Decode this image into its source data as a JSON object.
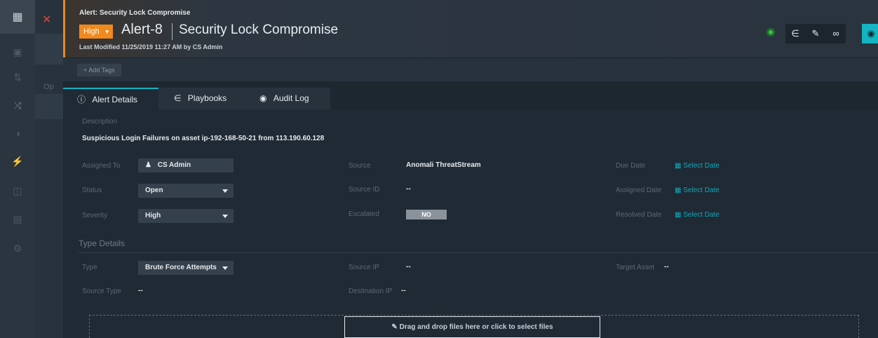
{
  "rail": {
    "icons": [
      "apps-icon",
      "dashboard-icon",
      "sort-icon",
      "shuffle-icon",
      "shield-icon",
      "bolt-icon",
      "briefcase-icon",
      "chart-icon",
      "settings-icon"
    ]
  },
  "back_panel": {
    "partial_label": "Op"
  },
  "header": {
    "breadcrumb": "Alert: Security Lock Compromise",
    "severity": "High",
    "alert_id": "Alert-8",
    "alert_name": "Security Lock Compromise",
    "last_modified": "Last Modified 11/25/2019 11:27 AM by CS Admin",
    "status_dot_color": "#3ac04b",
    "accent_color": "#f08a1d"
  },
  "tags": {
    "add_label": "+ Add Tags"
  },
  "tabs": [
    {
      "label": "Alert Details",
      "icon": "info-icon",
      "active": true
    },
    {
      "label": "Playbooks",
      "icon": "playbook-icon",
      "active": false
    },
    {
      "label": "Audit Log",
      "icon": "eye-icon",
      "active": false
    }
  ],
  "details": {
    "description_label": "Description",
    "description": "Suspicious Login Failures on asset ip-192-168-50-21 from 113.190.60.128",
    "assigned_to_label": "Assigned To",
    "assigned_to": "CS Admin",
    "status_label": "Status",
    "status": "Open",
    "severity_label": "Severity",
    "severity": "High",
    "source_label": "Source",
    "source": "Anomali ThreatStream",
    "source_id_label": "Source ID",
    "source_id": "--",
    "escalated_label": "Escalated",
    "escalated": "NO",
    "due_date_label": "Due Date",
    "assigned_date_label": "Assigned Date",
    "resolved_date_label": "Resolved Date",
    "select_date": "Select Date"
  },
  "type_details": {
    "heading": "Type Details",
    "type_label": "Type",
    "type": "Brute Force Attempts",
    "source_type_label": "Source Type",
    "source_type": "--",
    "source_ip_label": "Source IP",
    "source_ip": "--",
    "destination_ip_label": "Destination IP",
    "destination_ip": "--",
    "target_asset_label": "Target Asset",
    "target_asset": "--"
  },
  "upload": {
    "label": "Drag and drop files here or click to select files"
  },
  "colors": {
    "link": "#14a7b5",
    "accent": "#14b4c2",
    "danger": "#e0453a"
  }
}
